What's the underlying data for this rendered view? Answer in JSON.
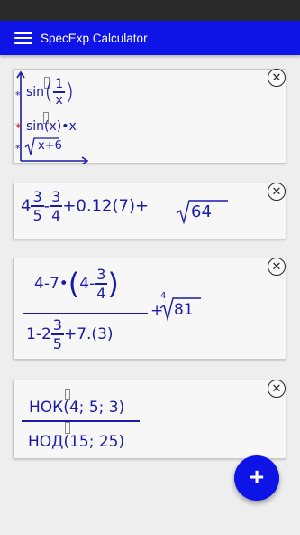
{
  "app": {
    "title": "SpecExp Calculator",
    "menu_icon": "hamburger-menu-icon"
  },
  "card1": {
    "line1_prefix": "sin",
    "line1_num": "1",
    "line1_den": "x",
    "line2": "sin(x)•x",
    "line3_radicand": "x+6"
  },
  "card2": {
    "whole": "4",
    "f1_num": "3",
    "f1_den": "5",
    "minus": "-",
    "f2_num": "3",
    "f2_den": "4",
    "tail": "+0.12(7)+",
    "radicand": "64"
  },
  "card3": {
    "num_prefix": "4-7•",
    "inner_prefix": "4-",
    "inner_num": "3",
    "inner_den": "4",
    "den_prefix": "1-2",
    "den_fnum": "3",
    "den_fden": "5",
    "den_suffix": "+7.(3)",
    "plus": "+",
    "root_index": "4",
    "radicand": "81"
  },
  "card4": {
    "numerator": "НОК(4; 5; 3)",
    "denominator": "НОД(15; 25)"
  },
  "fab": {
    "label": "+",
    "icon": "plus-icon"
  },
  "colors": {
    "primary": "#0e14e6",
    "math_text": "#1a1aa6",
    "cursor_red": "#e01010"
  }
}
